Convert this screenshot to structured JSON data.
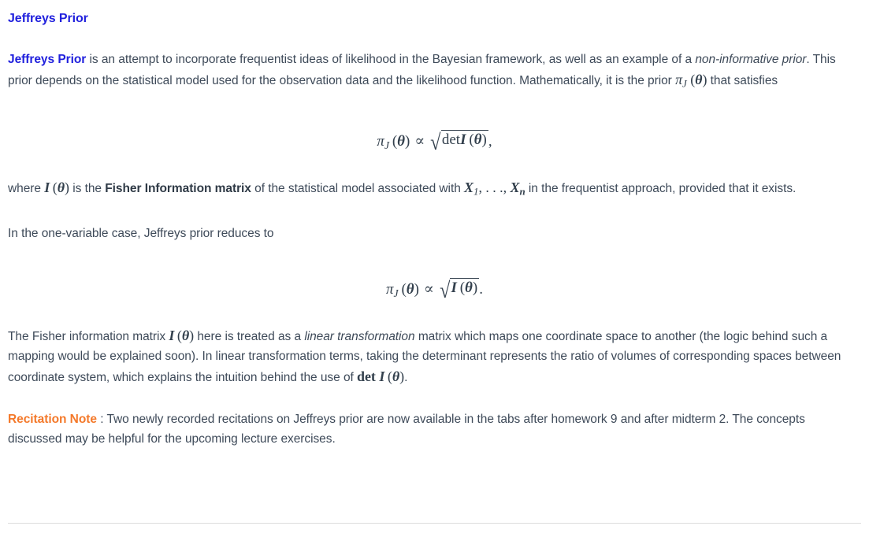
{
  "document": {
    "heading": "Jeffreys Prior",
    "colors": {
      "heading_blue": "#2020dd",
      "body_text": "#3e4a59",
      "note_orange": "#f4792a",
      "divider": "#dcdcdc",
      "background": "#ffffff"
    },
    "paragraphs": {
      "intro": {
        "lead_bold": "Jeffreys Prior",
        "text_1": " is an attempt to incorporate frequentist ideas of likelihood in the Bayesian framework, as well as an example of a ",
        "emphasis_1": "non-informative prior",
        "text_2": ". This prior depends on the statistical model used for the observation data and the likelihood function. Mathematically, it is the prior ",
        "inline_math_1": "π_J (θ)",
        "text_3": " that satisfies"
      },
      "where": {
        "text_1": "where ",
        "inline_math_1": "I (θ)",
        "text_2": " is the ",
        "bold_1": "Fisher Information matrix",
        "text_3": " of the statistical model associated with ",
        "inline_math_2": "X_1, . . ., X_n",
        "text_4": " in the frequentist approach, provided that it exists."
      },
      "one_variable": {
        "text": "In the one-variable case, Jeffreys prior reduces to"
      },
      "fisher_transform": {
        "text_1": "The Fisher information matrix ",
        "inline_math_1": "I (θ)",
        "text_2": " here is treated as a ",
        "emphasis_1": "linear transformation",
        "text_3": " matrix which maps one coordinate space to another (the logic behind such a mapping would be explained soon). In linear transformation terms, taking the determinant represents the ratio of volumes of corresponding spaces between coordinate system, which explains the intuition behind the use of ",
        "inline_math_2": "det I (θ)",
        "text_4": "."
      },
      "recitation_note": {
        "label": "Recitation Note",
        "separator": " : ",
        "text": "Two newly recorded recitations on Jeffreys prior are now available in the tabs after homework 9 and after midterm 2. The concepts discussed may be helpful for the upcoming lecture exercises."
      }
    },
    "equations": {
      "eq1": {
        "latex": "\\pi_J\\left(\\theta\\right)\\propto\\sqrt{\\det I\\left(\\theta\\right)},",
        "pi": "π",
        "sub_j": "J",
        "theta_open": "(",
        "theta": "θ",
        "theta_close": ")",
        "proportional": "∝",
        "radical": "√",
        "det": "det",
        "matrix_symbol": "I",
        "trailing": ","
      },
      "eq2": {
        "latex": "\\pi_J\\left(\\theta\\right)\\propto\\sqrt{I\\left(\\theta\\right)}.",
        "pi": "π",
        "sub_j": "J",
        "theta_open": "(",
        "theta": "θ",
        "theta_close": ")",
        "proportional": "∝",
        "radical": "√",
        "matrix_symbol": "I",
        "trailing": "."
      }
    },
    "inline_symbols": {
      "pi": "π",
      "sub_j": "J",
      "theta": "θ",
      "paren_open": "(",
      "paren_close": ")",
      "matrix_i": "I",
      "x": "X",
      "sub_1": "1",
      "sub_n": "n",
      "ellipsis": ", . . ., ",
      "comma": ",",
      "det": "det"
    }
  }
}
